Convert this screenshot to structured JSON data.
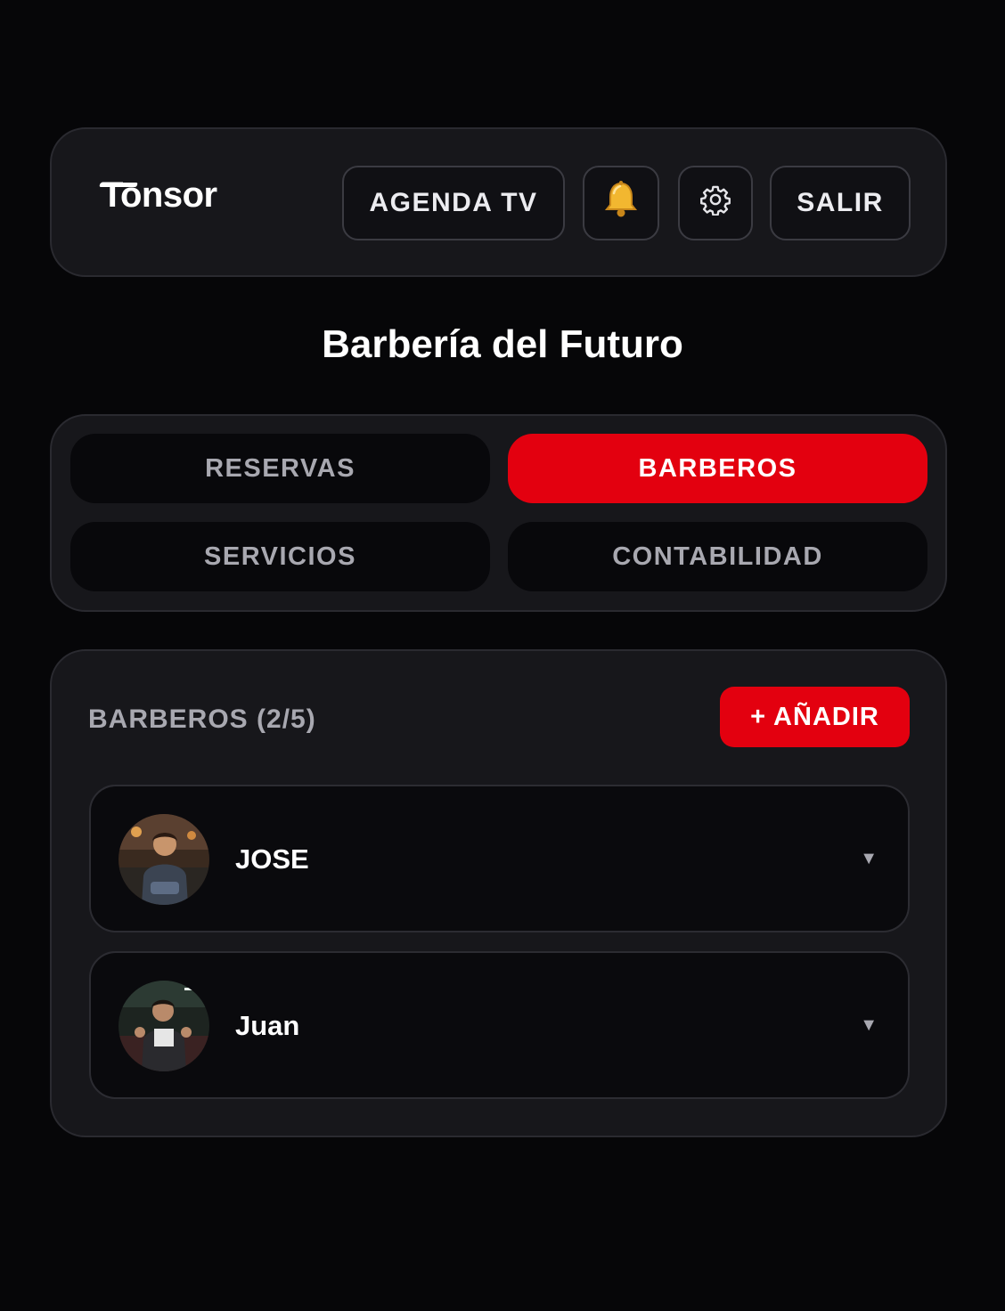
{
  "header": {
    "logo": "Tonsor",
    "agenda_label": "AGENDA TV",
    "bell_icon": "bell-icon",
    "gear_icon": "gear-icon",
    "logout_label": "SALIR"
  },
  "page_title": "Barbería del Futuro",
  "tabs": [
    {
      "label": "RESERVAS",
      "active": false
    },
    {
      "label": "BARBEROS",
      "active": true
    },
    {
      "label": "SERVICIOS",
      "active": false
    },
    {
      "label": "CONTABILIDAD",
      "active": false
    }
  ],
  "barbers": {
    "section_title": "BARBEROS (2/5)",
    "add_label": "+ AÑADIR",
    "items": [
      {
        "name": "JOSE",
        "chevron": "▼"
      },
      {
        "name": "Juan",
        "chevron": "▼"
      }
    ]
  },
  "colors": {
    "accent": "#e3000f",
    "background": "#060608",
    "card": "#17171b"
  }
}
